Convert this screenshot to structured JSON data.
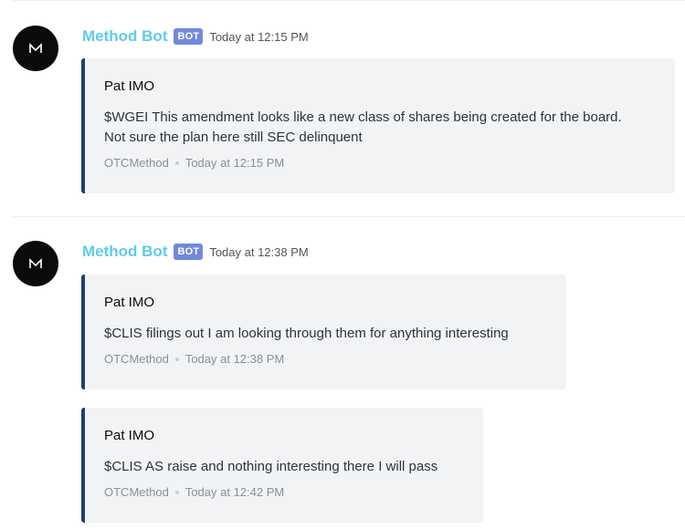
{
  "messages": [
    {
      "username": "Method Bot",
      "bot_tag": "BOT",
      "timestamp": "Today at 12:15 PM",
      "embeds": [
        {
          "author": "Pat IMO",
          "description": "$WGEI This amendment looks like a new class of shares being created for the board. Not sure the plan here still SEC delinquent",
          "footer_text": "OTCMethod",
          "footer_time": "Today at 12:15 PM"
        }
      ]
    },
    {
      "username": "Method Bot",
      "bot_tag": "BOT",
      "timestamp": "Today at 12:38 PM",
      "embeds": [
        {
          "author": "Pat IMO",
          "description": "$CLIS filings out I am looking through them for anything interesting",
          "footer_text": "OTCMethod",
          "footer_time": "Today at 12:38 PM"
        },
        {
          "author": "Pat IMO",
          "description": "$CLIS AS raise and nothing interesting there I will pass",
          "footer_text": "OTCMethod",
          "footer_time": "Today at 12:42 PM"
        }
      ]
    }
  ],
  "colors": {
    "username": "#5fcbe6",
    "bot_tag_bg": "#7289da",
    "embed_border": "#1f3f6e",
    "embed_bg": "#f2f3f5",
    "avatar_bg": "#0b0b0b"
  },
  "icons": {
    "avatar": "method-logo-icon"
  }
}
